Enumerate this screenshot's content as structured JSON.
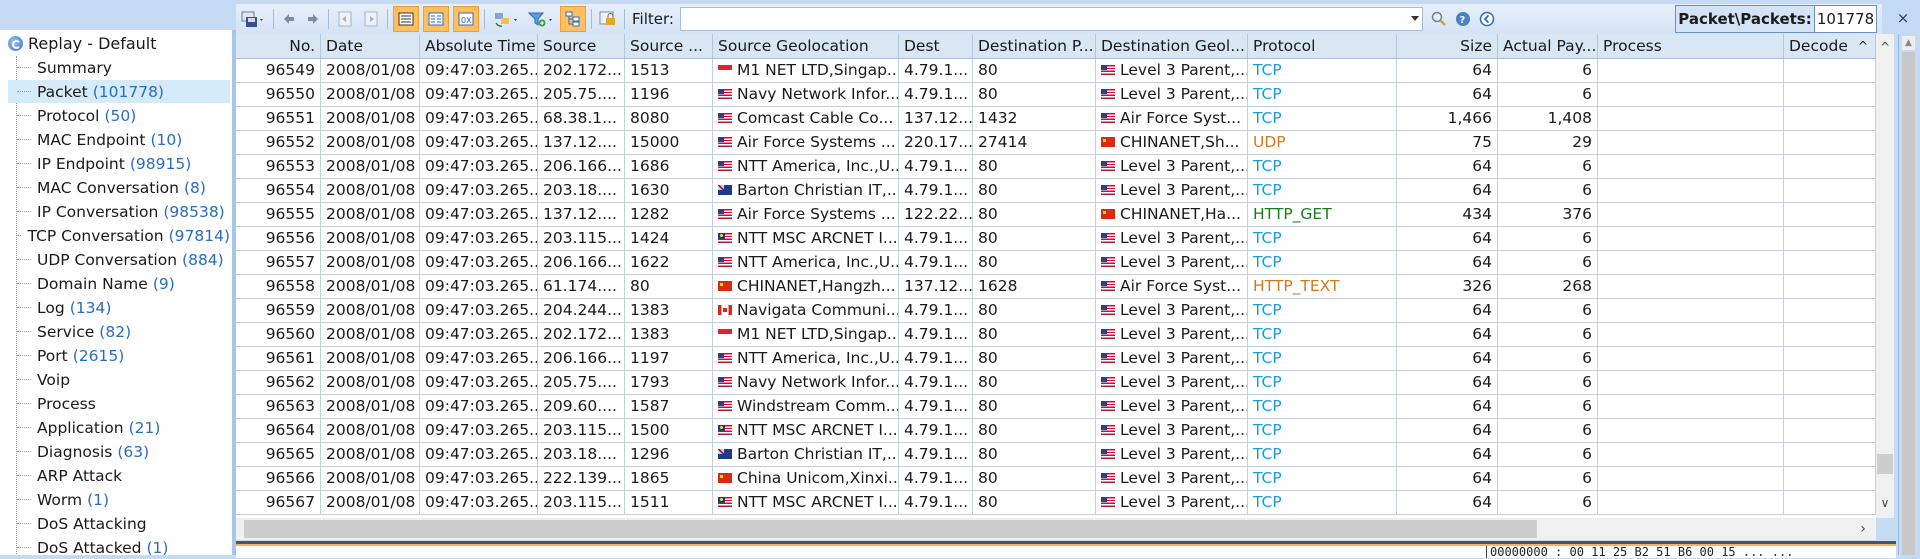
{
  "sidebar": {
    "root": {
      "label": "Replay - Default",
      "icon": "replay-icon"
    },
    "items": [
      {
        "label": "Summary",
        "count": ""
      },
      {
        "label": "Packet",
        "count": "(101778)",
        "selected": true
      },
      {
        "label": "Protocol",
        "count": "(50)"
      },
      {
        "label": "MAC Endpoint",
        "count": "(10)"
      },
      {
        "label": "IP Endpoint",
        "count": "(98915)"
      },
      {
        "label": "MAC Conversation",
        "count": "(8)"
      },
      {
        "label": "IP Conversation",
        "count": "(98538)"
      },
      {
        "label": "TCP Conversation",
        "count": "(97814)"
      },
      {
        "label": "UDP Conversation",
        "count": "(884)"
      },
      {
        "label": "Domain Name",
        "count": "(9)"
      },
      {
        "label": "Log",
        "count": "(134)"
      },
      {
        "label": "Service",
        "count": "(82)"
      },
      {
        "label": "Port",
        "count": "(2615)"
      },
      {
        "label": "Voip",
        "count": ""
      },
      {
        "label": "Process",
        "count": ""
      },
      {
        "label": "Application",
        "count": "(21)"
      },
      {
        "label": "Diagnosis",
        "count": "(63)"
      },
      {
        "label": "ARP Attack",
        "count": ""
      },
      {
        "label": "Worm",
        "count": "(1)"
      },
      {
        "label": "DoS Attacking",
        "count": ""
      },
      {
        "label": "DoS Attacked",
        "count": "(1)"
      }
    ]
  },
  "toolbar": {
    "filter_label": "Filter:",
    "filter_value": "",
    "counter_label": "Packet\\Packets:",
    "counter_value": "101778",
    "close_label": "×"
  },
  "table": {
    "columns": [
      "No.",
      "Date",
      "Absolute Time",
      "Source",
      "Source ...",
      "Source Geolocation",
      "Dest",
      "Destination P...",
      "Destination Geol...",
      "Protocol",
      "Size",
      "Actual Pay...",
      "Process",
      "Decode"
    ],
    "protocol_colors": {
      "TCP": "#1a9ad6",
      "UDP": "#d2791f",
      "HTTP_GET": "#1f7a1f",
      "HTTP_TEXT": "#d2791f"
    },
    "rows": [
      {
        "no": "96549",
        "date": "2008/01/08",
        "time": "09:47:03.265...",
        "src": "202.172...",
        "sport": "1513",
        "sflag": "sg",
        "sgeo": "M1 NET LTD,Singap...",
        "dst": "4.79.1...",
        "dport": "80",
        "dflag": "us",
        "dgeo": "Level 3 Parent,...",
        "proto": "TCP",
        "size": "64",
        "payload": "6"
      },
      {
        "no": "96550",
        "date": "2008/01/08",
        "time": "09:47:03.265...",
        "src": "205.75....",
        "sport": "1196",
        "sflag": "us",
        "sgeo": "Navy Network Infor...",
        "dst": "4.79.1...",
        "dport": "80",
        "dflag": "us",
        "dgeo": "Level 3 Parent,...",
        "proto": "TCP",
        "size": "64",
        "payload": "6"
      },
      {
        "no": "96551",
        "date": "2008/01/08",
        "time": "09:47:03.265...",
        "src": "68.38.1...",
        "sport": "8080",
        "sflag": "us",
        "sgeo": "Comcast Cable Co...",
        "dst": "137.12...",
        "dport": "1432",
        "dflag": "us",
        "dgeo": "Air Force Syst...",
        "proto": "TCP",
        "size": "1,466",
        "payload": "1,408"
      },
      {
        "no": "96552",
        "date": "2008/01/08",
        "time": "09:47:03.265...",
        "src": "137.12....",
        "sport": "15000",
        "sflag": "us",
        "sgeo": "Air Force Systems ...",
        "dst": "220.17...",
        "dport": "27414",
        "dflag": "cn",
        "dgeo": "CHINANET,Sh...",
        "proto": "UDP",
        "size": "75",
        "payload": "29"
      },
      {
        "no": "96553",
        "date": "2008/01/08",
        "time": "09:47:03.265...",
        "src": "206.166...",
        "sport": "1686",
        "sflag": "us",
        "sgeo": "NTT America, Inc.,U...",
        "dst": "4.79.1...",
        "dport": "80",
        "dflag": "us",
        "dgeo": "Level 3 Parent,...",
        "proto": "TCP",
        "size": "64",
        "payload": "6"
      },
      {
        "no": "96554",
        "date": "2008/01/08",
        "time": "09:47:03.265...",
        "src": "203.18....",
        "sport": "1630",
        "sflag": "au",
        "sgeo": "Barton Christian IT,...",
        "dst": "4.79.1...",
        "dport": "80",
        "dflag": "us",
        "dgeo": "Level 3 Parent,...",
        "proto": "TCP",
        "size": "64",
        "payload": "6"
      },
      {
        "no": "96555",
        "date": "2008/01/08",
        "time": "09:47:03.265...",
        "src": "137.12....",
        "sport": "1282",
        "sflag": "us",
        "sgeo": "Air Force Systems ...",
        "dst": "122.22...",
        "dport": "80",
        "dflag": "cn",
        "dgeo": "CHINANET,Ha...",
        "proto": "HTTP_GET",
        "size": "434",
        "payload": "376"
      },
      {
        "no": "96556",
        "date": "2008/01/08",
        "time": "09:47:03.265...",
        "src": "203.115...",
        "sport": "1424",
        "sflag": "my",
        "sgeo": "NTT MSC ARCNET I...",
        "dst": "4.79.1...",
        "dport": "80",
        "dflag": "us",
        "dgeo": "Level 3 Parent,...",
        "proto": "TCP",
        "size": "64",
        "payload": "6"
      },
      {
        "no": "96557",
        "date": "2008/01/08",
        "time": "09:47:03.265...",
        "src": "206.166...",
        "sport": "1622",
        "sflag": "us",
        "sgeo": "NTT America, Inc.,U...",
        "dst": "4.79.1...",
        "dport": "80",
        "dflag": "us",
        "dgeo": "Level 3 Parent,...",
        "proto": "TCP",
        "size": "64",
        "payload": "6"
      },
      {
        "no": "96558",
        "date": "2008/01/08",
        "time": "09:47:03.265...",
        "src": "61.174....",
        "sport": "80",
        "sflag": "cn",
        "sgeo": "CHINANET,Hangzh...",
        "dst": "137.12...",
        "dport": "1628",
        "dflag": "us",
        "dgeo": "Air Force Syst...",
        "proto": "HTTP_TEXT",
        "size": "326",
        "payload": "268"
      },
      {
        "no": "96559",
        "date": "2008/01/08",
        "time": "09:47:03.265...",
        "src": "204.244...",
        "sport": "1383",
        "sflag": "ca",
        "sgeo": "Navigata Communi...",
        "dst": "4.79.1...",
        "dport": "80",
        "dflag": "us",
        "dgeo": "Level 3 Parent,...",
        "proto": "TCP",
        "size": "64",
        "payload": "6"
      },
      {
        "no": "96560",
        "date": "2008/01/08",
        "time": "09:47:03.265...",
        "src": "202.172...",
        "sport": "1383",
        "sflag": "sg",
        "sgeo": "M1 NET LTD,Singap...",
        "dst": "4.79.1...",
        "dport": "80",
        "dflag": "us",
        "dgeo": "Level 3 Parent,...",
        "proto": "TCP",
        "size": "64",
        "payload": "6"
      },
      {
        "no": "96561",
        "date": "2008/01/08",
        "time": "09:47:03.265...",
        "src": "206.166...",
        "sport": "1197",
        "sflag": "us",
        "sgeo": "NTT America, Inc.,U...",
        "dst": "4.79.1...",
        "dport": "80",
        "dflag": "us",
        "dgeo": "Level 3 Parent,...",
        "proto": "TCP",
        "size": "64",
        "payload": "6"
      },
      {
        "no": "96562",
        "date": "2008/01/08",
        "time": "09:47:03.265...",
        "src": "205.75....",
        "sport": "1793",
        "sflag": "us",
        "sgeo": "Navy Network Infor...",
        "dst": "4.79.1...",
        "dport": "80",
        "dflag": "us",
        "dgeo": "Level 3 Parent,...",
        "proto": "TCP",
        "size": "64",
        "payload": "6"
      },
      {
        "no": "96563",
        "date": "2008/01/08",
        "time": "09:47:03.265...",
        "src": "209.60....",
        "sport": "1587",
        "sflag": "us",
        "sgeo": "Windstream Comm...",
        "dst": "4.79.1...",
        "dport": "80",
        "dflag": "us",
        "dgeo": "Level 3 Parent,...",
        "proto": "TCP",
        "size": "64",
        "payload": "6"
      },
      {
        "no": "96564",
        "date": "2008/01/08",
        "time": "09:47:03.265...",
        "src": "203.115...",
        "sport": "1500",
        "sflag": "my",
        "sgeo": "NTT MSC ARCNET I...",
        "dst": "4.79.1...",
        "dport": "80",
        "dflag": "us",
        "dgeo": "Level 3 Parent,...",
        "proto": "TCP",
        "size": "64",
        "payload": "6"
      },
      {
        "no": "96565",
        "date": "2008/01/08",
        "time": "09:47:03.265...",
        "src": "203.18....",
        "sport": "1296",
        "sflag": "au",
        "sgeo": "Barton Christian IT,...",
        "dst": "4.79.1...",
        "dport": "80",
        "dflag": "us",
        "dgeo": "Level 3 Parent,...",
        "proto": "TCP",
        "size": "64",
        "payload": "6"
      },
      {
        "no": "96566",
        "date": "2008/01/08",
        "time": "09:47:03.265...",
        "src": "222.139...",
        "sport": "1865",
        "sflag": "cn",
        "sgeo": "China Unicom,Xinxi...",
        "dst": "4.79.1...",
        "dport": "80",
        "dflag": "us",
        "dgeo": "Level 3 Parent,...",
        "proto": "TCP",
        "size": "64",
        "payload": "6"
      },
      {
        "no": "96567",
        "date": "2008/01/08",
        "time": "09:47:03.265...",
        "src": "203.115...",
        "sport": "1511",
        "sflag": "my",
        "sgeo": "NTT MSC ARCNET I...",
        "dst": "4.79.1...",
        "dport": "80",
        "dflag": "us",
        "dgeo": "Level 3 Parent,...",
        "proto": "TCP",
        "size": "64",
        "payload": "6"
      }
    ]
  },
  "hex_pane": {
    "line": "00000000 : 00 11 25 B2 51 B6 00 15 ... ..."
  },
  "scroll": {
    "vertical_fraction": 0.95,
    "horizontal_fraction": 0.0
  }
}
